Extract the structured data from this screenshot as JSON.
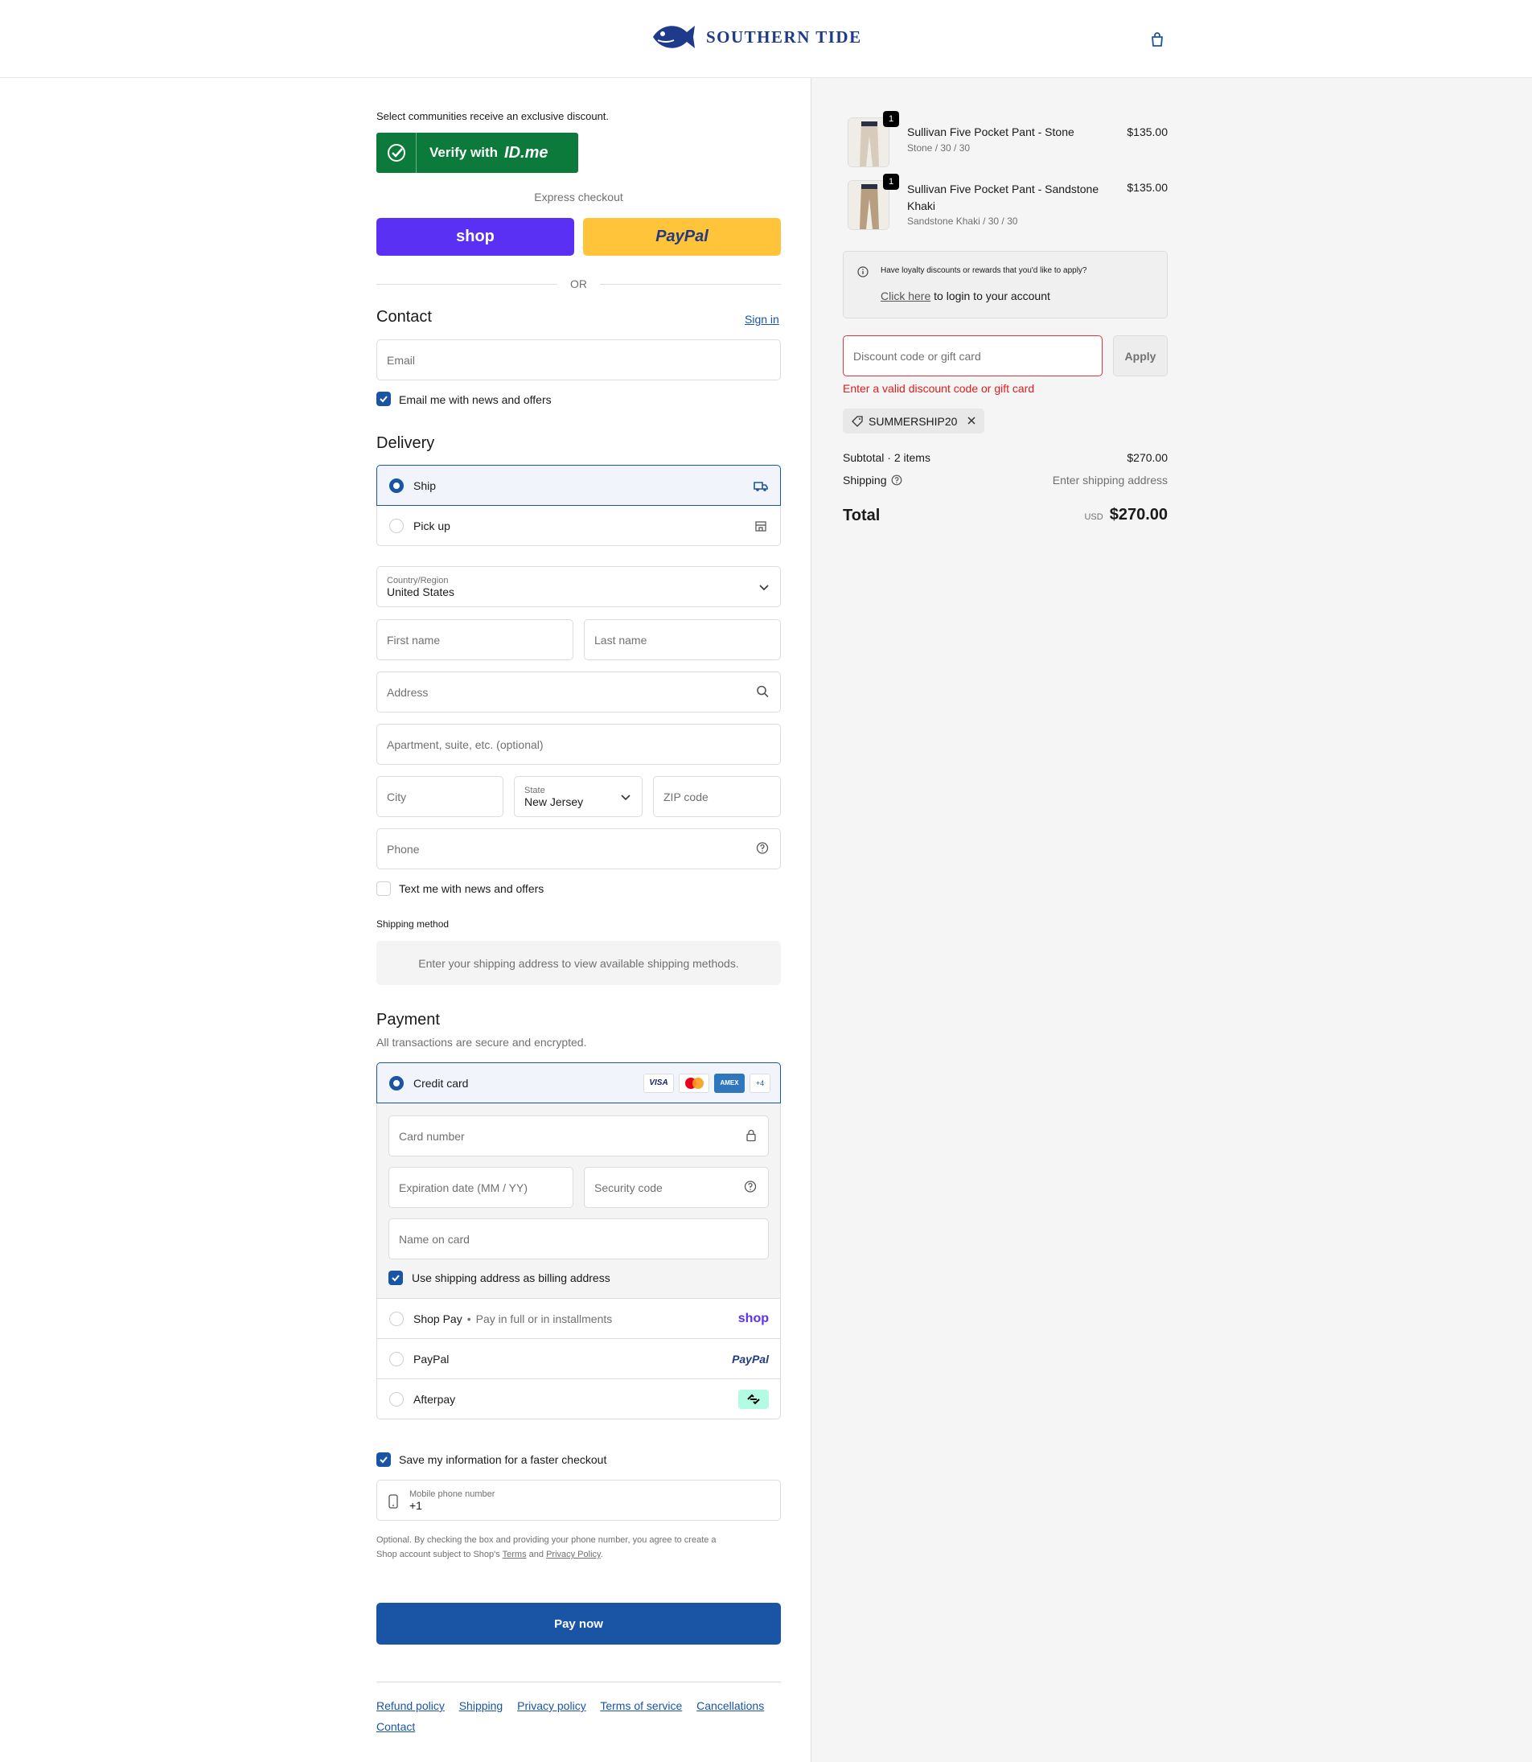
{
  "brand": {
    "name": "SOUTHERN TIDE",
    "accent": "#1a54a5"
  },
  "idme": {
    "intro": "Select communities receive an exclusive discount.",
    "button_label": "Verify with",
    "logo_text": "ID.me"
  },
  "express": {
    "title": "Express checkout",
    "shop_label": "shop",
    "paypal_label": "PayPal",
    "or_label": "OR"
  },
  "contact": {
    "heading": "Contact",
    "signin": "Sign in",
    "email_placeholder": "Email",
    "news_label": "Email me with news and offers"
  },
  "delivery": {
    "heading": "Delivery",
    "options": [
      "Ship",
      "Pick up"
    ],
    "country_label": "Country/Region",
    "country_value": "United States",
    "first_name": "First name",
    "last_name": "Last name",
    "address": "Address",
    "apartment": "Apartment, suite, etc. (optional)",
    "city": "City",
    "state_label": "State",
    "state_value": "New Jersey",
    "zip": "ZIP code",
    "phone": "Phone",
    "text_label": "Text me with news and offers"
  },
  "shipping_method": {
    "heading": "Shipping method",
    "note": "Enter your shipping address to view available shipping methods."
  },
  "payment": {
    "heading": "Payment",
    "subtitle": "All transactions are secure and encrypted.",
    "credit_card": "Credit card",
    "card_badges": [
      "VISA",
      "",
      "AMEX",
      "+4"
    ],
    "card_number": "Card number",
    "expiration": "Expiration date (MM / YY)",
    "security": "Security code",
    "name_on_card": "Name on card",
    "billing_label": "Use shipping address as billing address",
    "shop_pay": "Shop Pay",
    "shop_pay_note": "Pay in full or in installments",
    "shop_pay_logo": "shop",
    "paypal": "PayPal",
    "paypal_logo": "PayPal",
    "afterpay": "Afterpay"
  },
  "save_info": {
    "label": "Save my information for a faster checkout",
    "phone_label": "Mobile phone number",
    "phone_value": "+1",
    "legal_1": "Optional. By checking the box and providing your phone number, you agree to create a",
    "legal_2": "Shop account subject to Shop's",
    "terms": "Terms",
    "and": "and",
    "privacy": "Privacy Policy",
    "period": "."
  },
  "pay_now": "Pay now",
  "footer_links": [
    "Refund policy",
    "Shipping",
    "Privacy policy",
    "Terms of service",
    "Cancellations",
    "Contact"
  ],
  "cart": {
    "items": [
      {
        "qty": "1",
        "name": "Sullivan Five Pocket Pant - Stone",
        "variant": "Stone / 30 / 30",
        "price": "$135.00"
      },
      {
        "qty": "1",
        "name_line1": "Sullivan Five Pocket Pant - Sandstone",
        "name_line2": "Khaki",
        "variant": "Sandstone Khaki / 30 / 30",
        "price": "$135.00"
      }
    ],
    "loyalty_question": "Have loyalty discounts or rewards that you'd like to apply?",
    "loyalty_link": "Click here",
    "loyalty_rest": "to login to your account",
    "discount_placeholder": "Discount code or gift card",
    "apply": "Apply",
    "error": "Enter a valid discount code or gift card",
    "applied_code": "SUMMERSHIP20",
    "subtotal_label": "Subtotal · 2 items",
    "subtotal_value": "$270.00",
    "shipping_label": "Shipping",
    "shipping_value": "Enter shipping address",
    "total_label": "Total",
    "currency": "USD",
    "total_value": "$270.00"
  }
}
